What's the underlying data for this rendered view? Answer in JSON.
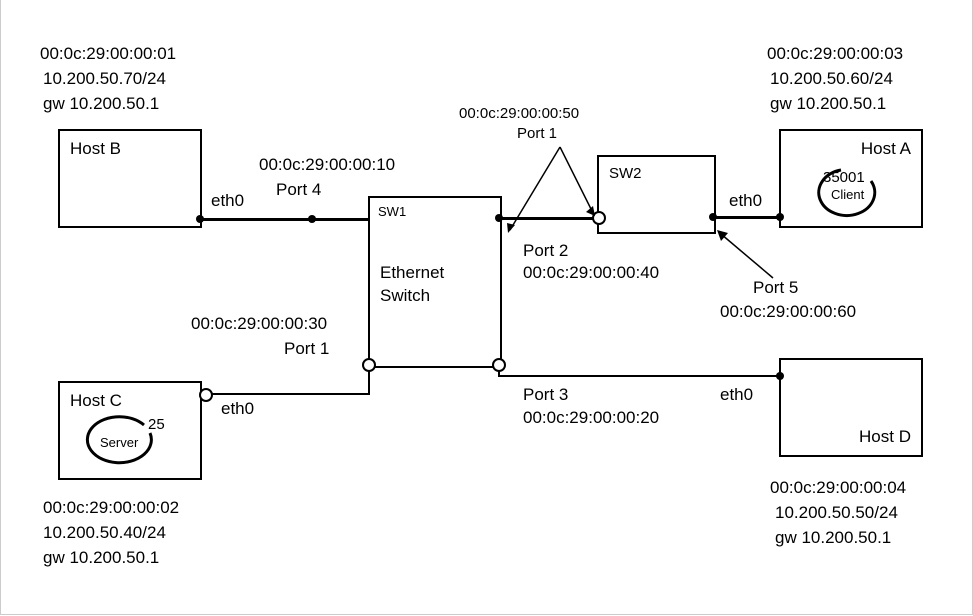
{
  "hosts": {
    "hostB": {
      "name": "Host B",
      "mac": "00:0c:29:00:00:01",
      "ip": "10.200.50.70/24",
      "gw": "gw 10.200.50.1",
      "iface": "eth0"
    },
    "hostA": {
      "name": "Host A",
      "mac": "00:0c:29:00:00:03",
      "ip": "10.200.50.60/24",
      "gw": "gw 10.200.50.1",
      "iface": "eth0",
      "app_port": "35001",
      "role": "Client"
    },
    "hostC": {
      "name": "Host C",
      "mac": "00:0c:29:00:00:02",
      "ip": "10.200.50.40/24",
      "gw": "gw 10.200.50.1",
      "iface": "eth0",
      "app_port": "25",
      "role": "Server"
    },
    "hostD": {
      "name": "Host D",
      "mac": "00:0c:29:00:00:04",
      "ip": "10.200.50.50/24",
      "gw": "gw 10.200.50.1",
      "iface": "eth0"
    }
  },
  "switches": {
    "sw1": {
      "label": "SW1",
      "title": "Ethernet\nSwitch",
      "title1": "Ethernet",
      "title2": "Switch",
      "ports": {
        "port4": {
          "label": "Port 4",
          "mac": "00:0c:29:00:00:10"
        },
        "port1": {
          "label": "Port 1",
          "mac": "00:0c:29:00:00:30"
        },
        "port2": {
          "label": "Port 2",
          "mac": "00:0c:29:00:00:40"
        },
        "port3": {
          "label": "Port 3",
          "mac": "00:0c:29:00:00:20"
        }
      }
    },
    "sw2": {
      "label": "SW2",
      "ports": {
        "port1": {
          "label": "Port 1",
          "mac": "00:0c:29:00:00:50"
        },
        "port5": {
          "label": "Port 5",
          "mac": "00:0c:29:00:00:60"
        }
      }
    }
  }
}
